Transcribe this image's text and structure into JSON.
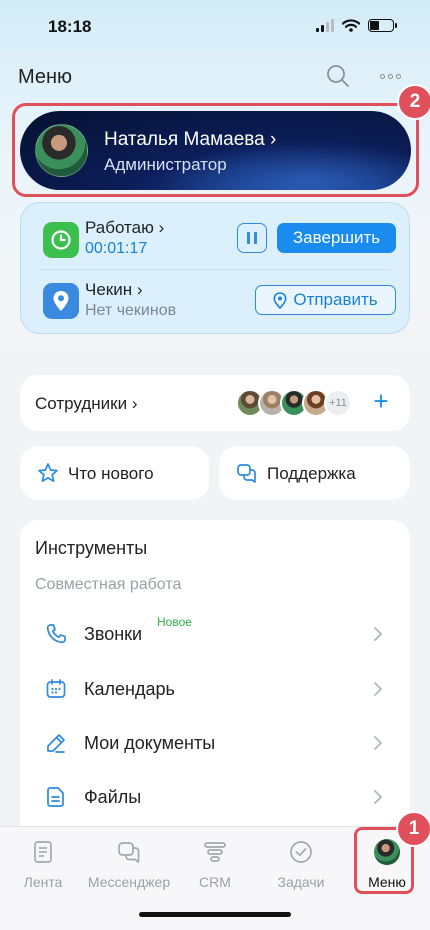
{
  "status_bar": {
    "time": "18:18"
  },
  "header": {
    "title": "Меню"
  },
  "profile": {
    "name": "Наталья Мамаева",
    "role": "Администратор"
  },
  "annotations": {
    "badge_profile": "2",
    "badge_menu": "1"
  },
  "work": {
    "status_label": "Работаю",
    "timer": "00:01:17",
    "finish_label": "Завершить",
    "checkin_label": "Чекин",
    "checkin_sub": "Нет чекинов",
    "send_label": "Отправить"
  },
  "staff": {
    "label": "Сотрудники",
    "extra_count": "+11"
  },
  "quick": {
    "news_label": "Что нового",
    "support_label": "Поддержка"
  },
  "tools": {
    "title": "Инструменты",
    "section": "Совместная работа",
    "items": [
      {
        "label": "Звонки",
        "badge": "Новое",
        "icon": "phone-icon"
      },
      {
        "label": "Календарь",
        "icon": "calendar-icon"
      },
      {
        "label": "Мои документы",
        "icon": "pen-icon"
      },
      {
        "label": "Файлы",
        "icon": "file-icon"
      }
    ]
  },
  "tabs": [
    {
      "label": "Лента",
      "icon": "feed-icon"
    },
    {
      "label": "Мессенджер",
      "icon": "chat-icon"
    },
    {
      "label": "CRM",
      "icon": "crm-icon"
    },
    {
      "label": "Задачи",
      "icon": "check-circle-icon"
    },
    {
      "label": "Меню",
      "icon": "avatar"
    }
  ],
  "colors": {
    "accent": "#1a8cf0",
    "highlight": "#e0505a",
    "new_badge": "#2db54a",
    "work_green": "#3bbf4f"
  }
}
